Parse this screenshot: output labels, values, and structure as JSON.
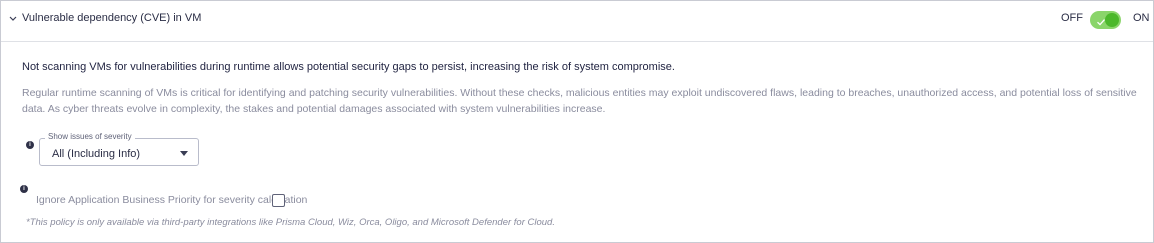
{
  "header": {
    "title": "Vulnerable dependency (CVE) in VM",
    "toggle": {
      "off_label": "OFF",
      "on_label": "ON",
      "state": "on",
      "accent": "#4cb82b"
    }
  },
  "body": {
    "warning": "Not scanning VMs for vulnerabilities during runtime allows potential security gaps to persist, increasing the risk of system compromise.",
    "description": "Regular runtime scanning of VMs is critical for identifying and patching security vulnerabilities. Without these checks, malicious entities may exploit undiscovered flaws, leading to breaches, unauthorized access, and potential loss of sensitive data. As cyber threats evolve in complexity, the stakes and potential damages associated with system vulnerabilities increase.",
    "severity": {
      "legend": "Show issues of severity",
      "value": "All (Including Info)",
      "info_icon": "info-icon"
    },
    "ignore_priority": {
      "label": "Ignore Application Business Priority for severity calculation",
      "checked": false,
      "info_icon": "info-icon"
    },
    "footnote": "*This policy is only available via third-party integrations like Prisma Cloud, Wiz, Orca, Oligo, and Microsoft Defender for Cloud."
  }
}
